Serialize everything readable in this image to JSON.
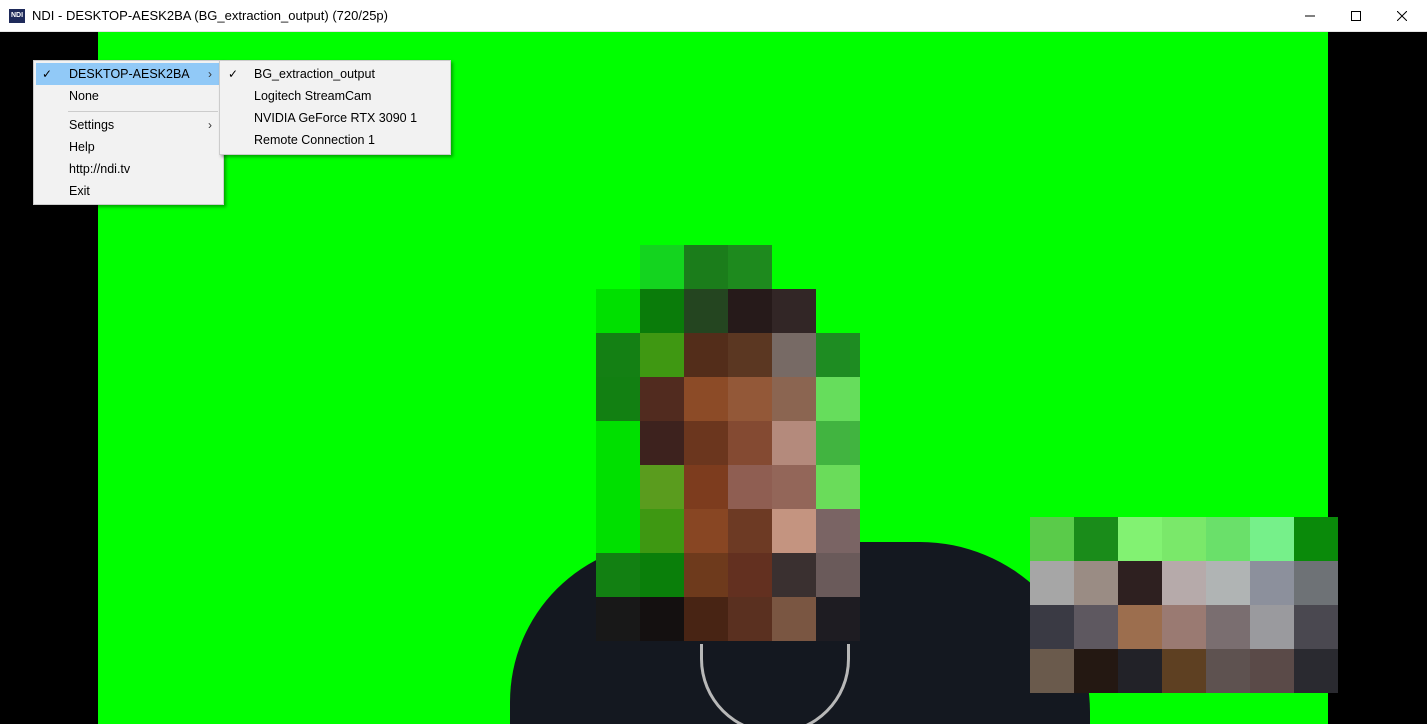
{
  "window": {
    "title": "NDI - DESKTOP-AESK2BA (BG_extraction_output) (720/25p)",
    "icon_text": "NDI",
    "minimize_glyph": "—",
    "maximize_glyph": "☐",
    "close_glyph": "✕"
  },
  "menu": {
    "items": [
      {
        "label": "DESKTOP-AESK2BA",
        "checked": true,
        "has_submenu": true,
        "highlighted": true
      },
      {
        "label": "None"
      },
      {
        "label": "Settings",
        "has_submenu": true
      },
      {
        "label": "Help"
      },
      {
        "label": "http://ndi.tv"
      },
      {
        "label": "Exit"
      }
    ],
    "check_glyph": "✓",
    "arrow_glyph": "›"
  },
  "submenu": {
    "items": [
      {
        "label": "BG_extraction_output",
        "checked": true
      },
      {
        "label": "Logitech StreamCam"
      },
      {
        "label": "NVIDIA GeForce RTX 3090 1"
      },
      {
        "label": "Remote Connection 1"
      }
    ]
  },
  "colors": {
    "background_key": "#00ff00",
    "menu_background": "#f2f2f2",
    "menu_highlight": "#91c9f7"
  }
}
